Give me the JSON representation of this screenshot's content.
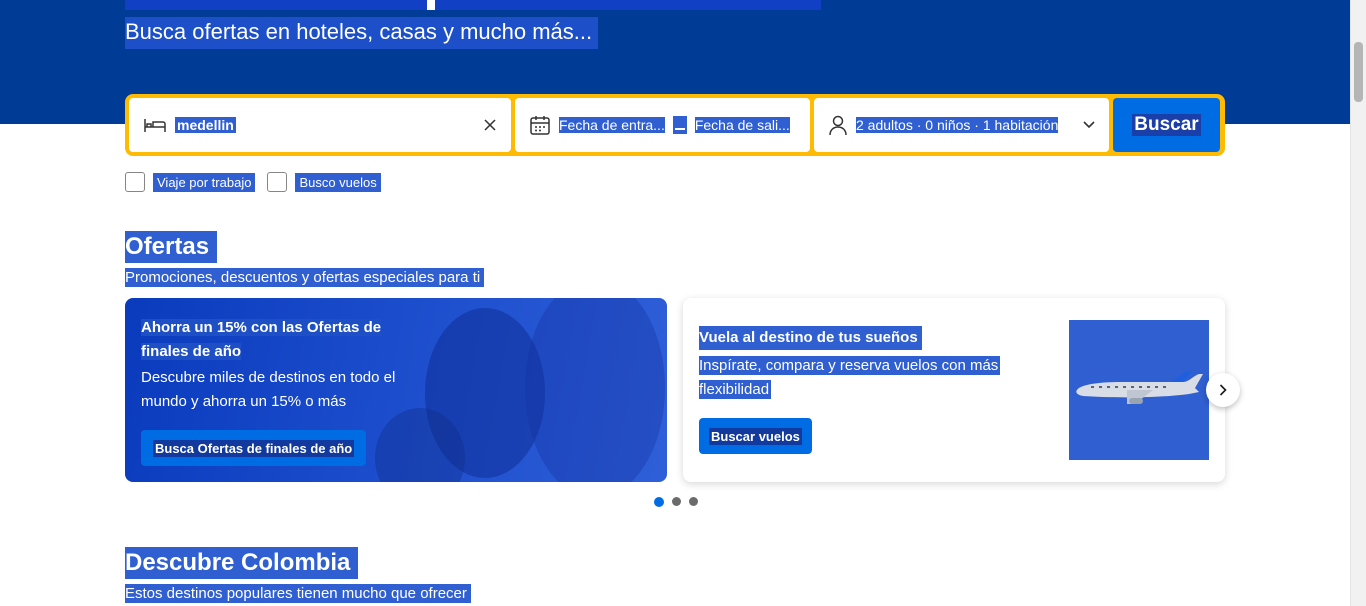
{
  "hero": {
    "subtitle": "Busca ofertas en hoteles, casas y mucho más..."
  },
  "search": {
    "destination_value": "medellin",
    "checkin_label": "Fecha de entra...",
    "checkout_label": "Fecha de sali...",
    "guests_label": "2 adultos · 0 niños · 1 habitación",
    "search_button": "Buscar"
  },
  "options": {
    "work_trip": "Viaje por trabajo",
    "flights": "Busco vuelos"
  },
  "offers": {
    "title": "Ofertas",
    "subtitle": "Promociones, descuentos y ofertas especiales para ti",
    "cards": [
      {
        "title": "Ahorra un 15% con las Ofertas de finales de año",
        "description": "Descubre miles de destinos en todo el mundo y ahorra un 15% o más",
        "button": "Busca Ofertas de finales de año"
      },
      {
        "title": "Vuela al destino de tus sueños",
        "description_line1": "Inspírate, compara y reserva vuelos con más",
        "description_line2": "flexibilidad",
        "button": "Buscar vuelos"
      }
    ],
    "carousel": {
      "pages": 3,
      "active": 1
    }
  },
  "discover": {
    "title": "Descubre Colombia",
    "subtitle": "Estos destinos populares tienen mucho que ofrecer"
  },
  "icons": {
    "bed": "bed-icon",
    "calendar": "calendar-icon",
    "person": "person-icon",
    "clear": "close-icon",
    "chevron": "chevron-down-icon",
    "next": "chevron-right-icon",
    "plane": "airplane-icon"
  },
  "colors": {
    "brand_blue": "#003b95",
    "accent_yellow": "#febb02",
    "button_blue": "#006ce4",
    "selection": "#2f5fd0"
  }
}
